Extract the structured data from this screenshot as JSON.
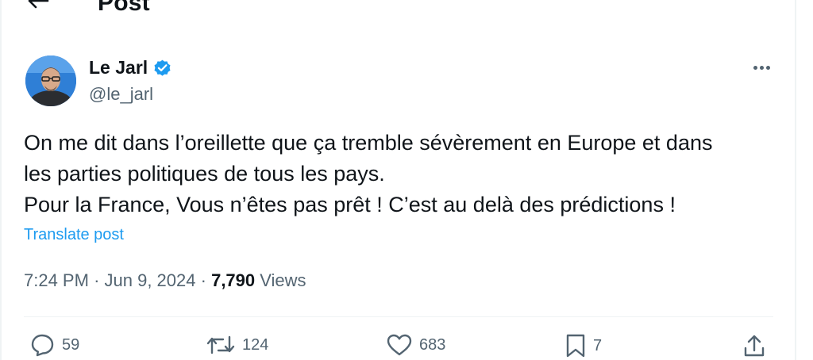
{
  "header": {
    "title": "Post",
    "back_icon": "arrow-left-icon"
  },
  "author": {
    "display_name": "Le Jarl",
    "handle": "@le_jarl",
    "verified_icon": "verified-badge-icon",
    "verified_color": "#1d9bf0"
  },
  "post": {
    "lines": [
      "On me dit dans l’oreillette que ça tremble sévèrement en Europe et dans",
      "les parties politiques de tous les pays.",
      "Pour la France, Vous n’êtes pas prêt ! C’est au delà des prédictions !"
    ],
    "translate_label": "Translate post",
    "time": "7:24 PM",
    "date": "Jun 9, 2024",
    "views_count": "7,790",
    "views_label": "Views"
  },
  "actions": {
    "replies": "59",
    "reposts": "124",
    "likes": "683",
    "bookmarks": "7"
  },
  "colors": {
    "accent": "#1d9bf0",
    "text_primary": "#0f1419",
    "text_secondary": "#536471",
    "border": "#eff3f4"
  }
}
